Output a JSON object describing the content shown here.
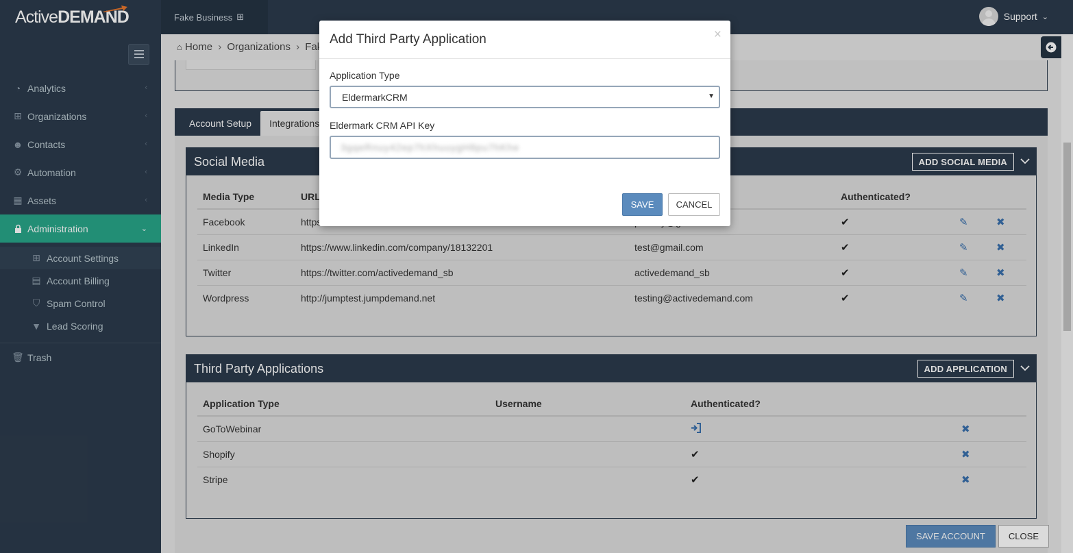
{
  "app": {
    "logo_part1": "Active",
    "logo_part2": "DEMAND",
    "business_name": "Fake Business",
    "user_name": "Support"
  },
  "sidebar": {
    "items": [
      {
        "label": "Analytics",
        "icon": "dashboard-icon"
      },
      {
        "label": "Organizations",
        "icon": "sitemap-icon"
      },
      {
        "label": "Contacts",
        "icon": "users-icon"
      },
      {
        "label": "Automation",
        "icon": "cogs-icon"
      },
      {
        "label": "Assets",
        "icon": "th-large-icon"
      },
      {
        "label": "Administration",
        "icon": "lock-icon"
      }
    ],
    "subitems": [
      {
        "label": "Account Settings",
        "icon": "sitemap-icon"
      },
      {
        "label": "Account Billing",
        "icon": "file-icon"
      },
      {
        "label": "Spam Control",
        "icon": "shield-icon"
      },
      {
        "label": "Lead Scoring",
        "icon": "filter-icon"
      }
    ],
    "trash": "Trash"
  },
  "breadcrumb": {
    "home": "Home",
    "organizations": "Organizations",
    "current": "Fake"
  },
  "tabs": {
    "account_setup": "Account Setup",
    "integrations": "Integrations"
  },
  "social_media": {
    "title": "Social Media",
    "add_button": "ADD SOCIAL MEDIA",
    "headers": [
      "Media Type",
      "URL",
      "",
      "Authenticated?"
    ],
    "rows": [
      {
        "type": "Facebook",
        "url": "https://www.facebook.com/activedemandtest",
        "user": "pbeatty@gmail.com"
      },
      {
        "type": "LinkedIn",
        "url": "https://www.linkedin.com/company/18132201",
        "user": "test@gmail.com"
      },
      {
        "type": "Twitter",
        "url": "https://twitter.com/activedemand_sb",
        "user": "activedemand_sb"
      },
      {
        "type": "Wordpress",
        "url": "http://jumptest.jumpdemand.net",
        "user": "testing@activedemand.com"
      }
    ]
  },
  "third_party": {
    "title": "Third Party Applications",
    "add_button": "ADD APPLICATION",
    "headers": [
      "Application Type",
      "Username",
      "Authenticated?"
    ],
    "rows": [
      {
        "type": "GoToWebinar",
        "auth": "signin"
      },
      {
        "type": "Shopify",
        "auth": "check"
      },
      {
        "type": "Stripe",
        "auth": "check"
      }
    ]
  },
  "footer": {
    "save": "SAVE ACCOUNT",
    "close": "CLOSE"
  },
  "modal": {
    "title": "Add Third Party Application",
    "close_symbol": "×",
    "app_type_label": "Application Type",
    "app_type_value": "EldermarkCRM",
    "api_key_label": "Eldermark CRM API Key",
    "api_key_value": "3gqeRnuy42ep7hXhuuygH8pu7hKhe",
    "save": "SAVE",
    "cancel": "CANCEL"
  },
  "colors": {
    "sidebar_bg": "#2c3b4c",
    "active_green": "#28a689",
    "primary_blue": "#5b8bbd",
    "icon_blue": "#3a70ad"
  }
}
